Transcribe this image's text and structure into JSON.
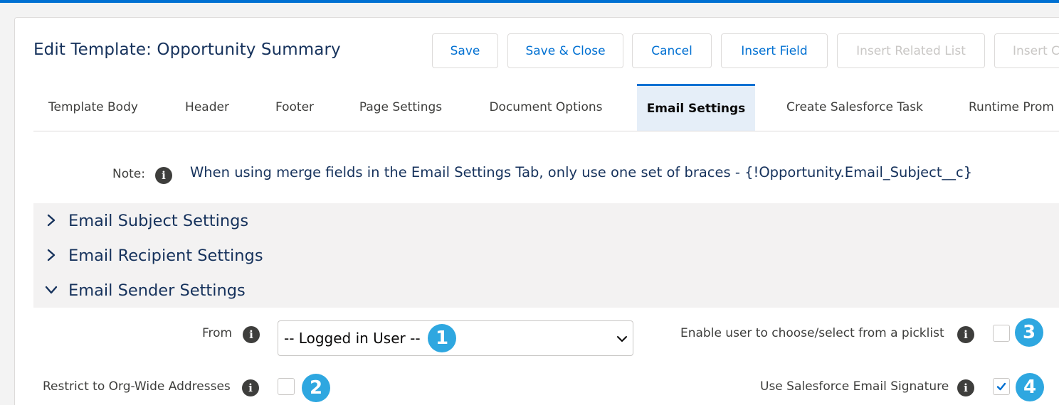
{
  "page_title": "Edit Template: Opportunity Summary",
  "toolbar": {
    "save": "Save",
    "save_close": "Save & Close",
    "cancel": "Cancel",
    "insert_field": "Insert Field",
    "insert_related_list": "Insert Related List",
    "insert_cut": "Insert C"
  },
  "tabs": [
    {
      "label": "Template Body"
    },
    {
      "label": "Header"
    },
    {
      "label": "Footer"
    },
    {
      "label": "Page Settings"
    },
    {
      "label": "Document Options"
    },
    {
      "label": "Email Settings",
      "active": true
    },
    {
      "label": "Create Salesforce Task"
    },
    {
      "label": "Runtime Prom"
    }
  ],
  "note": {
    "label": "Note:",
    "icon": "info-icon",
    "text": "When using merge fields in the Email Settings Tab, only use one set of braces - {!Opportunity.Email_Subject__c}"
  },
  "sections": [
    {
      "title": "Email Subject Settings",
      "expanded": false
    },
    {
      "title": "Email Recipient Settings",
      "expanded": false
    },
    {
      "title": "Email Sender Settings",
      "expanded": true
    }
  ],
  "sender": {
    "from_label": "From",
    "from_value": "-- Logged in User --",
    "picklist_label": "Enable user to choose/select from a picklist",
    "picklist_checked": false,
    "restrict_label": "Restrict to Org-Wide Addresses",
    "restrict_checked": false,
    "signature_label": "Use Salesforce Email Signature",
    "signature_checked": true
  },
  "callouts": [
    "1",
    "2",
    "3",
    "4"
  ],
  "colors": {
    "accent": "#0070d2",
    "title": "#16325c",
    "callout": "#2ea7e0",
    "section_bg": "#f3f2f2"
  }
}
